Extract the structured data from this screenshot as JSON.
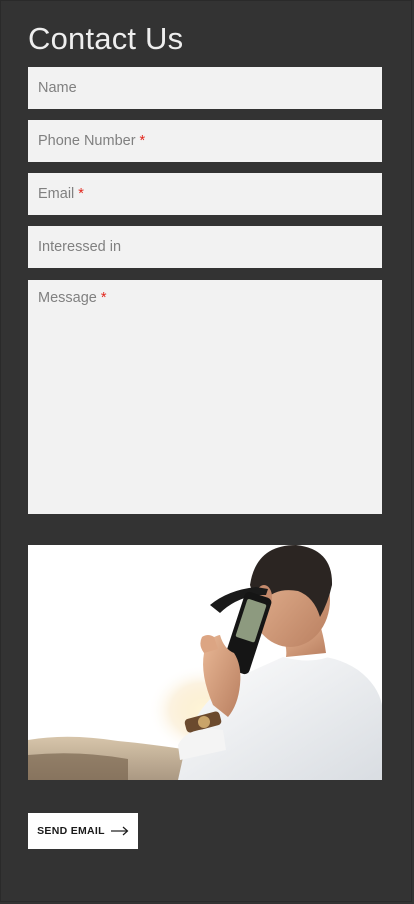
{
  "page": {
    "title": "Contact Us"
  },
  "form": {
    "name": {
      "placeholder": "Name",
      "required_mark": ""
    },
    "phone": {
      "placeholder": "Phone Number",
      "required_mark": "*"
    },
    "email": {
      "placeholder": "Email",
      "required_mark": "*"
    },
    "interest": {
      "placeholder": "Interessed in",
      "required_mark": ""
    },
    "message": {
      "placeholder": "Message",
      "required_mark": "*"
    }
  },
  "send_button": {
    "label": "SEND EMAIL",
    "icon": "arrow-right-icon"
  },
  "colors": {
    "background": "#333333",
    "field_background": "#f2f2f2",
    "placeholder_text": "#808080",
    "required_mark": "#e2261c",
    "button_background": "#ffffff"
  },
  "image": {
    "subject": "man-on-phone-photo"
  }
}
